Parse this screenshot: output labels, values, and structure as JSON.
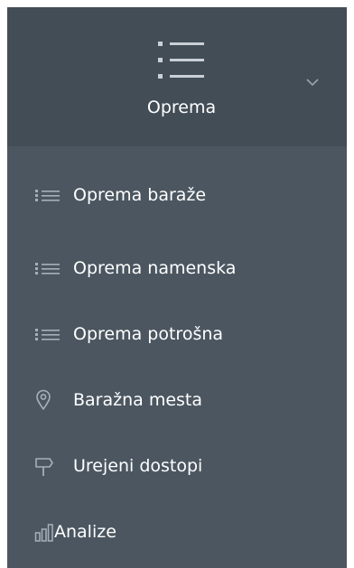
{
  "header": {
    "title": "Oprema",
    "icon": "list-icon",
    "toggle_icon": "chevron-down-icon"
  },
  "items": [
    {
      "label": "Oprema baraže",
      "icon": "list-icon"
    },
    {
      "label": "Oprema namenska",
      "icon": "list-icon"
    },
    {
      "label": "Oprema potrošna",
      "icon": "list-icon"
    },
    {
      "label": "Baražna mesta",
      "icon": "map-pin-icon"
    },
    {
      "label": "Urejeni dostopi",
      "icon": "signpost-icon"
    },
    {
      "label": "Analize",
      "icon": "bar-chart-icon"
    }
  ],
  "colors": {
    "panel": "#4b5660",
    "header": "#434d56",
    "text": "#ffffff",
    "icon": "#a6b0b9"
  }
}
